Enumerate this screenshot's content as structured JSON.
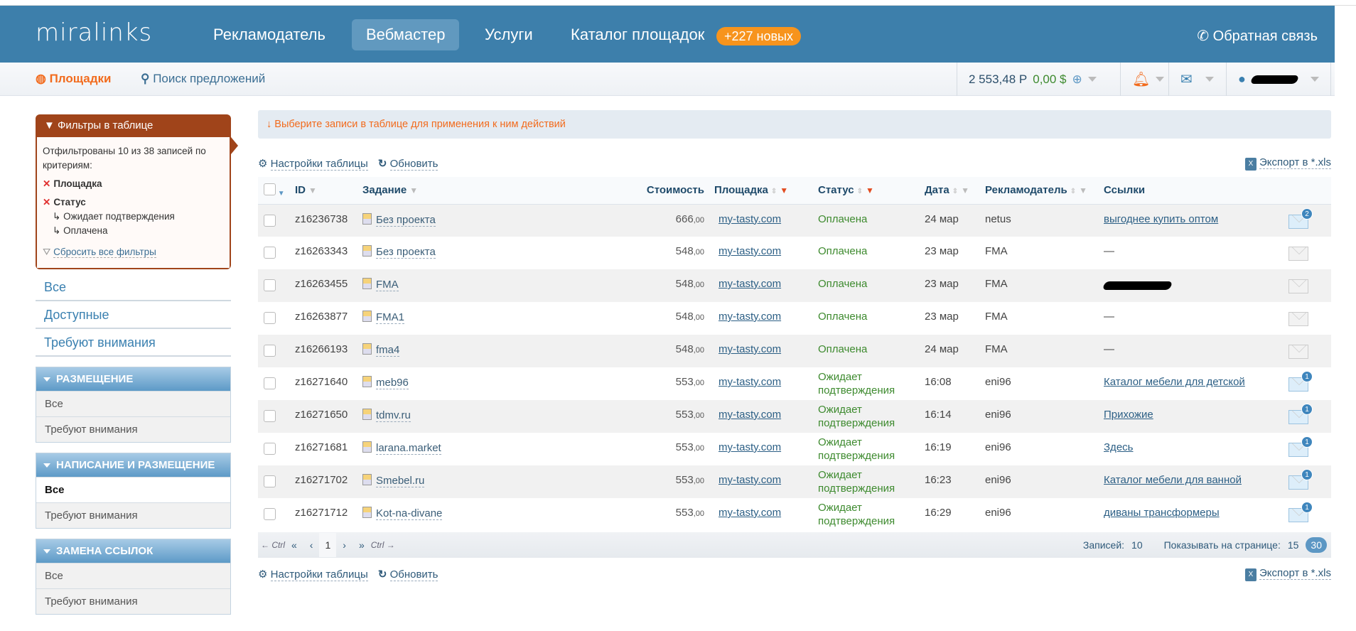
{
  "header": {
    "logo": "miralinks",
    "nav": [
      "Рекламодатель",
      "Вебмастер",
      "Услуги",
      "Каталог площадок"
    ],
    "catalog_badge": "+227 новых",
    "feedback": "Обратная связь"
  },
  "subnav": {
    "sites": "Площадки",
    "search": "Поиск предложений",
    "balance_rub": "2 553,48 Р",
    "balance_usd": "0,00 $"
  },
  "filters": {
    "title": "Фильтры в таблице",
    "summary": "Отфильтрованы 10 из 38 записей по критериям:",
    "criteria": [
      "Площадка",
      "Статус"
    ],
    "status_values": [
      "Ожидает подтверждения",
      "Оплачена"
    ],
    "reset": "Сбросить все фильтры"
  },
  "sidebar": {
    "links": [
      "Все",
      "Доступные",
      "Требуют внимания"
    ],
    "sections": [
      {
        "title": "РАЗМЕЩЕНИЕ",
        "items": [
          "Все",
          "Требуют внимания"
        ]
      },
      {
        "title": "НАПИСАНИЕ И РАЗМЕЩЕНИЕ",
        "items": [
          "Все",
          "Требуют внимания"
        ]
      },
      {
        "title": "ЗАМЕНА ССЫЛОК",
        "items": [
          "Все",
          "Требуют внимания"
        ]
      }
    ]
  },
  "main": {
    "info": "Выберите записи в таблице для применения к ним действий",
    "settings": "Настройки таблицы",
    "refresh": "Обновить",
    "export": "Экспорт в *.xls"
  },
  "table": {
    "columns": [
      "ID",
      "Задание",
      "Стоимость",
      "Площадка",
      "Статус",
      "Дата",
      "Рекламодатель",
      "Ссылки"
    ],
    "rows": [
      {
        "id": "z16236738",
        "task": "Без проекта",
        "price": "666",
        "cents": ",00",
        "site": "my-tasty.com",
        "status": "Оплачена",
        "date": "24 мар",
        "adv": "netus",
        "link": "выгоднее купить оптом",
        "msgs": "2"
      },
      {
        "id": "z16263343",
        "task": "Без проекта",
        "price": "548",
        "cents": ",00",
        "site": "my-tasty.com",
        "status": "Оплачена",
        "date": "23 мар",
        "adv": "FMA",
        "link": "—",
        "msgs": ""
      },
      {
        "id": "z16263455",
        "task": "FMA",
        "price": "548",
        "cents": ",00",
        "site": "my-tasty.com",
        "status": "Оплачена",
        "date": "23 мар",
        "adv": "FMA",
        "link": "",
        "msgs": ""
      },
      {
        "id": "z16263877",
        "task": "FMA1",
        "price": "548",
        "cents": ",00",
        "site": "my-tasty.com",
        "status": "Оплачена",
        "date": "23 мар",
        "adv": "FMA",
        "link": "—",
        "msgs": ""
      },
      {
        "id": "z16266193",
        "task": "fma4",
        "price": "548",
        "cents": ",00",
        "site": "my-tasty.com",
        "status": "Оплачена",
        "date": "24 мар",
        "adv": "FMA",
        "link": "—",
        "msgs": ""
      },
      {
        "id": "z16271640",
        "task": "meb96",
        "price": "553",
        "cents": ",00",
        "site": "my-tasty.com",
        "status": "Ожидает подтверждения",
        "date": "16:08",
        "adv": "eni96",
        "link": "Каталог мебели для детской",
        "msgs": "1"
      },
      {
        "id": "z16271650",
        "task": "tdmv.ru",
        "price": "553",
        "cents": ",00",
        "site": "my-tasty.com",
        "status": "Ожидает подтверждения",
        "date": "16:14",
        "adv": "eni96",
        "link": "Прихожие",
        "msgs": "1"
      },
      {
        "id": "z16271681",
        "task": "larana.market",
        "price": "553",
        "cents": ",00",
        "site": "my-tasty.com",
        "status": "Ожидает подтверждения",
        "date": "16:19",
        "adv": "eni96",
        "link": "Здесь",
        "msgs": "1"
      },
      {
        "id": "z16271702",
        "task": "Smebel.ru",
        "price": "553",
        "cents": ",00",
        "site": "my-tasty.com",
        "status": "Ожидает подтверждения",
        "date": "16:23",
        "adv": "eni96",
        "link": "Каталог мебели для ванной",
        "msgs": "1"
      },
      {
        "id": "z16271712",
        "task": "Kot-na-divane",
        "price": "553",
        "cents": ",00",
        "site": "my-tasty.com",
        "status": "Ожидает подтверждения",
        "date": "16:29",
        "adv": "eni96",
        "link": "диваны трансформеры",
        "msgs": "1"
      }
    ]
  },
  "pager": {
    "prev_ctrl": "← Ctrl",
    "first": "«",
    "prev": "‹",
    "page": "1",
    "next": "›",
    "last": "»",
    "next_ctrl": "Ctrl →",
    "records_label": "Записей:",
    "records": "10",
    "per_page_label": "Показывать на странице:",
    "per_page_options": [
      "15",
      "30"
    ]
  }
}
